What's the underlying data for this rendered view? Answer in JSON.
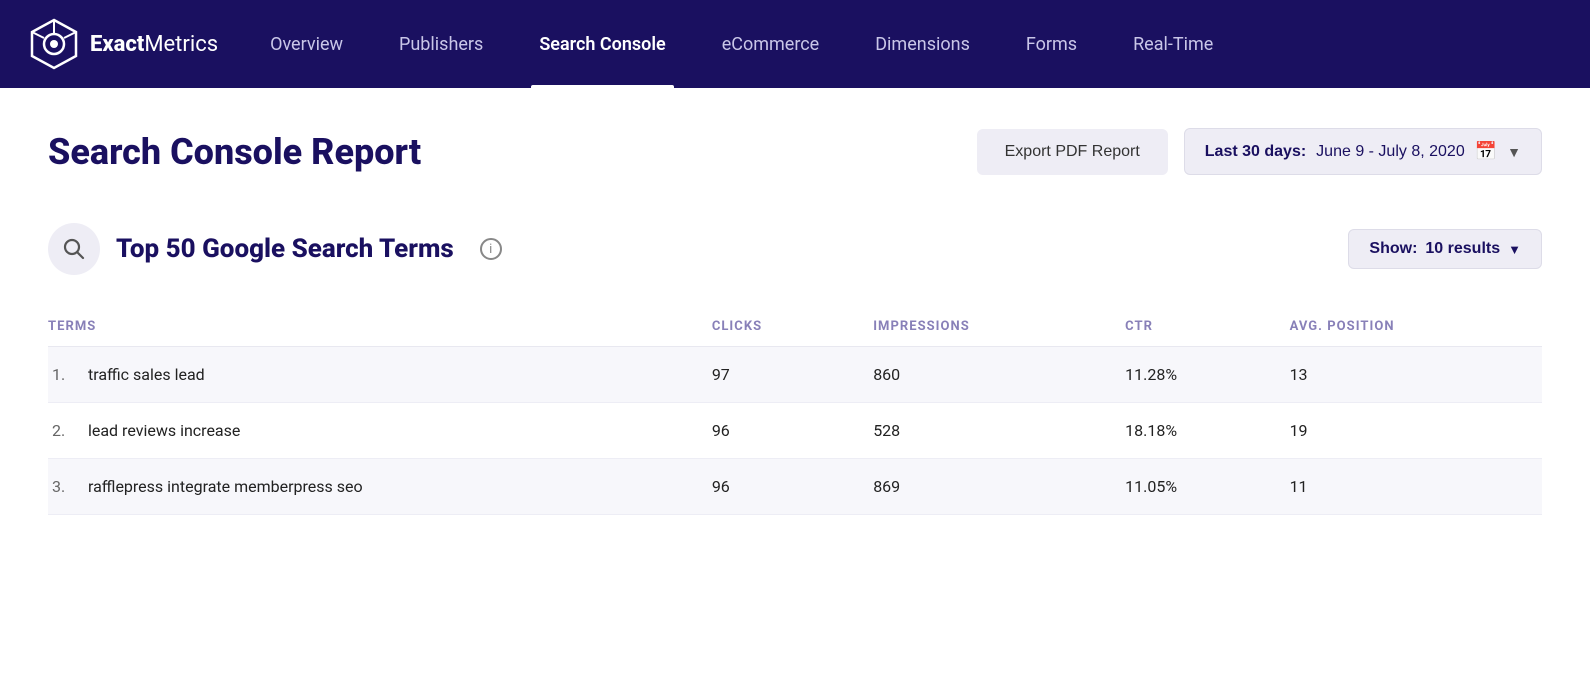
{
  "brand": {
    "name_bold": "Exact",
    "name_regular": "Metrics"
  },
  "nav": {
    "items": [
      {
        "id": "overview",
        "label": "Overview",
        "active": false
      },
      {
        "id": "publishers",
        "label": "Publishers",
        "active": false
      },
      {
        "id": "search-console",
        "label": "Search Console",
        "active": true
      },
      {
        "id": "ecommerce",
        "label": "eCommerce",
        "active": false
      },
      {
        "id": "dimensions",
        "label": "Dimensions",
        "active": false
      },
      {
        "id": "forms",
        "label": "Forms",
        "active": false
      },
      {
        "id": "real-time",
        "label": "Real-Time",
        "active": false
      }
    ]
  },
  "page": {
    "title": "Search Console Report",
    "export_button": "Export PDF Report",
    "date_range_label": "Last 30 days:",
    "date_range_value": "June 9 - July 8, 2020"
  },
  "section": {
    "title": "Top 50 Google Search Terms",
    "show_label": "Show:",
    "show_value": "10 results"
  },
  "table": {
    "headers": {
      "terms": "TERMS",
      "clicks": "CLICKS",
      "impressions": "IMPRESSIONS",
      "ctr": "CTR",
      "avg_position": "AVG. POSITION"
    },
    "rows": [
      {
        "num": "1.",
        "term": "traffic sales lead",
        "clicks": "97",
        "impressions": "860",
        "ctr": "11.28%",
        "avg_position": "13"
      },
      {
        "num": "2.",
        "term": "lead reviews increase",
        "clicks": "96",
        "impressions": "528",
        "ctr": "18.18%",
        "avg_position": "19"
      },
      {
        "num": "3.",
        "term": "rafflepress integrate memberpress seo",
        "clicks": "96",
        "impressions": "869",
        "ctr": "11.05%",
        "avg_position": "11"
      }
    ]
  }
}
